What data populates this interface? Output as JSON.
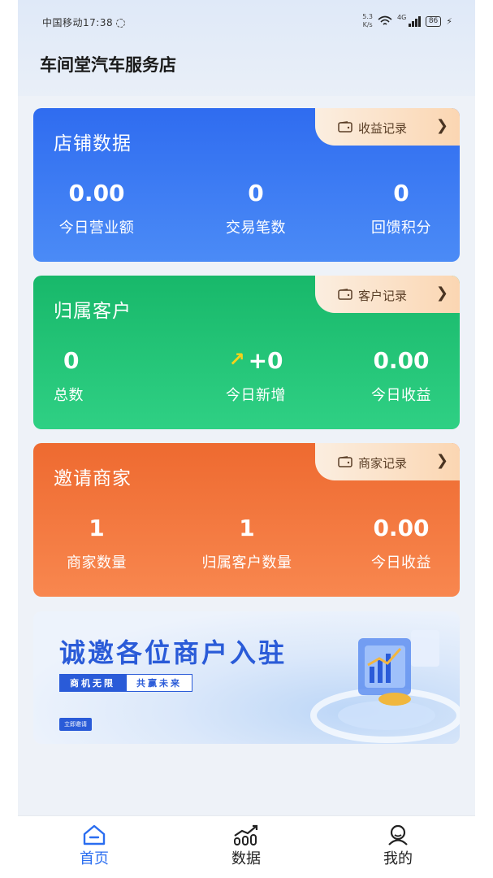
{
  "status_bar": {
    "carrier_time": "中国移动17:38",
    "speed_top": "5.3",
    "speed_bottom": "K/s",
    "network": "4G",
    "battery": "86"
  },
  "header": {
    "title": "车间堂汽车服务店"
  },
  "cards": {
    "store": {
      "title": "店铺数据",
      "record_label": "收益记录",
      "stats": [
        {
          "value": "0.00",
          "label": "今日营业额"
        },
        {
          "value": "0",
          "label": "交易笔数"
        },
        {
          "value": "0",
          "label": "回馈积分"
        }
      ]
    },
    "customers": {
      "title": "归属客户",
      "record_label": "客户记录",
      "stats": [
        {
          "value": "0",
          "label": "总数"
        },
        {
          "value": "+0",
          "label": "今日新增"
        },
        {
          "value": "0.00",
          "label": "今日收益"
        }
      ]
    },
    "merchants": {
      "title": "邀请商家",
      "record_label": "商家记录",
      "stats": [
        {
          "value": "1",
          "label": "商家数量"
        },
        {
          "value": "1",
          "label": "归属客户数量"
        },
        {
          "value": "0.00",
          "label": "今日收益"
        }
      ]
    }
  },
  "banner": {
    "title": "诚邀各位商户入驻",
    "chip_left": "商机无限",
    "chip_right": "共赢未来",
    "button": "立即邀请"
  },
  "tabbar": {
    "items": [
      {
        "label": "首页",
        "icon": "home-icon"
      },
      {
        "label": "数据",
        "icon": "chart-icon"
      },
      {
        "label": "我的",
        "icon": "user-icon"
      }
    ]
  },
  "colors": {
    "blue_card": "#2f6cf0",
    "green_card": "#18b86a",
    "orange_card": "#ee6a30",
    "active_tab": "#2a6df0"
  }
}
